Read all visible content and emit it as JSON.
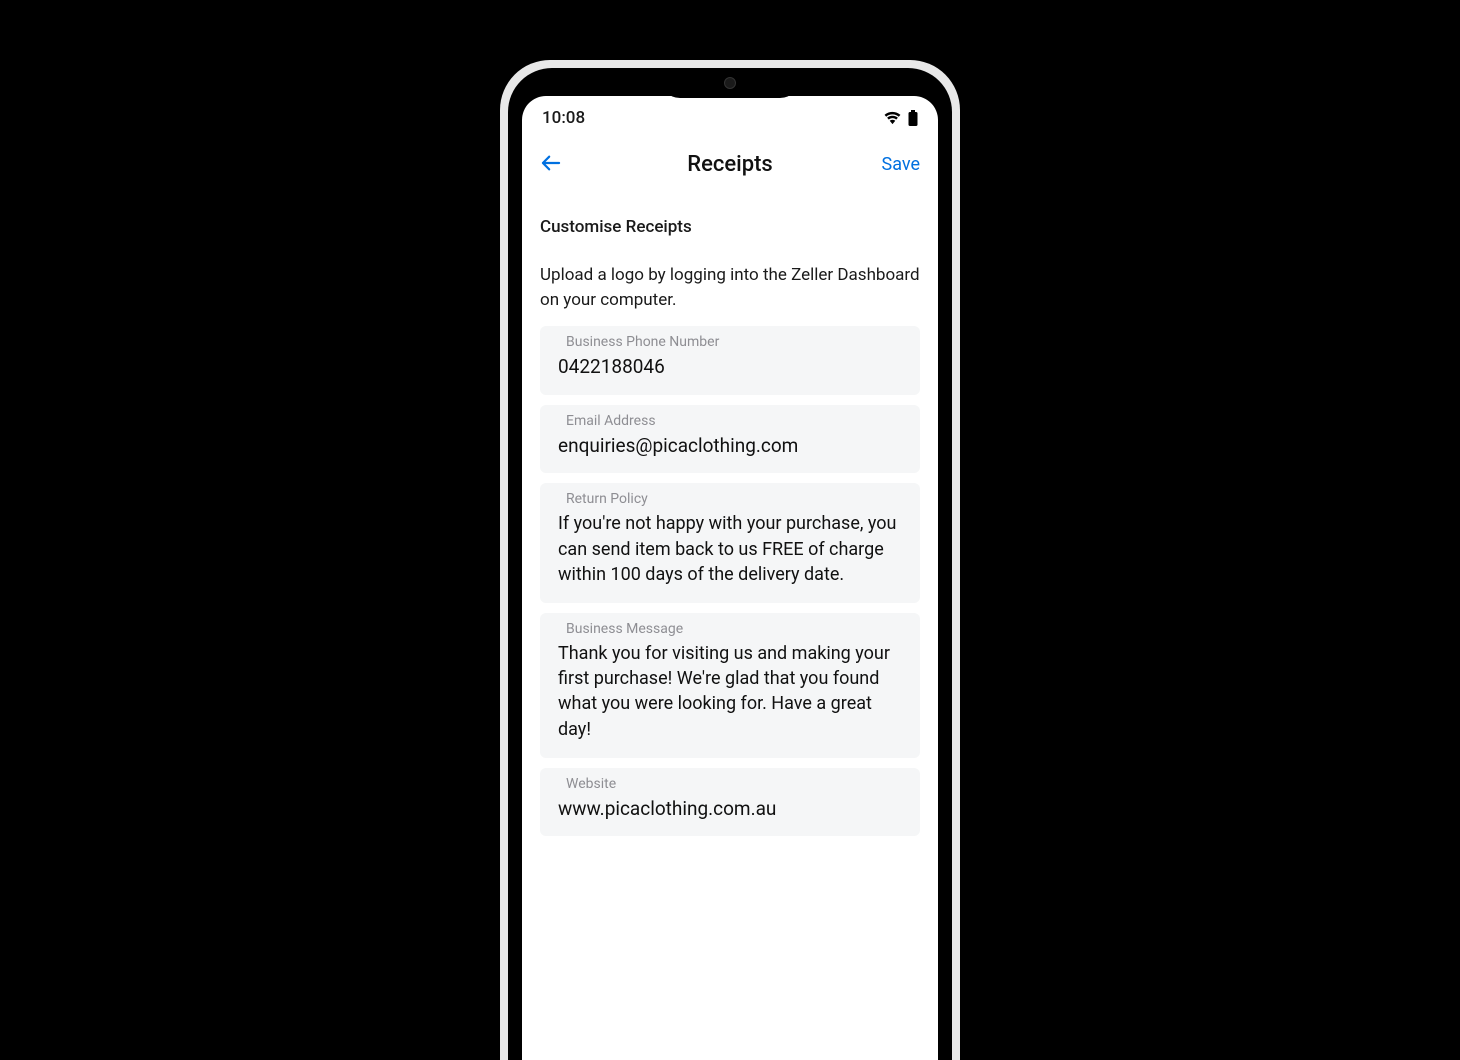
{
  "status": {
    "time": "10:08"
  },
  "nav": {
    "title": "Receipts",
    "save_label": "Save"
  },
  "section": {
    "header": "Customise Receipts",
    "helper": "Upload a logo by logging into the Zeller Dashboard on your computer."
  },
  "fields": {
    "phone": {
      "label": "Business Phone Number",
      "value": "0422188046"
    },
    "email": {
      "label": "Email Address",
      "value": "enquiries@picaclothing.com"
    },
    "return_policy": {
      "label": "Return Policy",
      "value": "If you're not happy with your purchase, you can send item back to us FREE of charge within 100 days of the delivery date."
    },
    "business_message": {
      "label": "Business Message",
      "value": "Thank you for visiting us and making your first purchase! We're glad that you found what you were looking for. Have a great day!"
    },
    "website": {
      "label": "Website",
      "value": "www.picaclothing.com.au"
    }
  }
}
